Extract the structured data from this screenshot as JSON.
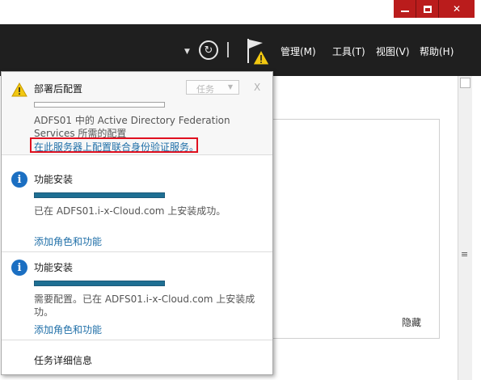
{
  "window": {
    "minimize_icon": "minimize-icon",
    "maximize_icon": "maximize-icon",
    "close_icon": "close-icon",
    "close_symbol": "✕",
    "accent": "#ba1c1c"
  },
  "toolbar": {
    "background": "#1f1f1f",
    "dropdown_symbol": "▼",
    "refresh_symbol": "↻",
    "menu": {
      "manage": "管理(M)",
      "tools": "工具(T)",
      "view": "视图(V)",
      "help": "帮助(H)"
    }
  },
  "notifications": [
    {
      "type": "warning",
      "icon": "warning-icon",
      "title": "部署后配置",
      "task_button": "任务",
      "dismiss": "X",
      "progress": 0,
      "description": "ADFS01 中的 Active Directory Federation Services 所需的配置",
      "link": "在此服务器上配置联合身份验证服务。",
      "link_highlight_color": "#e0101f"
    },
    {
      "type": "info",
      "icon": "info-icon",
      "icon_symbol": "i",
      "title": "功能安装",
      "progress": 1.0,
      "description": "已在 ADFS01.i-x-Cloud.com 上安装成功。",
      "link": "添加角色和功能"
    },
    {
      "type": "info",
      "icon": "info-icon",
      "icon_symbol": "i",
      "title": "功能安装",
      "progress": 1.0,
      "description": "需要配置。已在 ADFS01.i-x-Cloud.com 上安装成功。",
      "link": "添加角色和功能"
    }
  ],
  "footer": {
    "task_details": "任务详细信息"
  },
  "main": {
    "hide_label": "隐藏",
    "scroll_grip_symbol": "≡"
  }
}
